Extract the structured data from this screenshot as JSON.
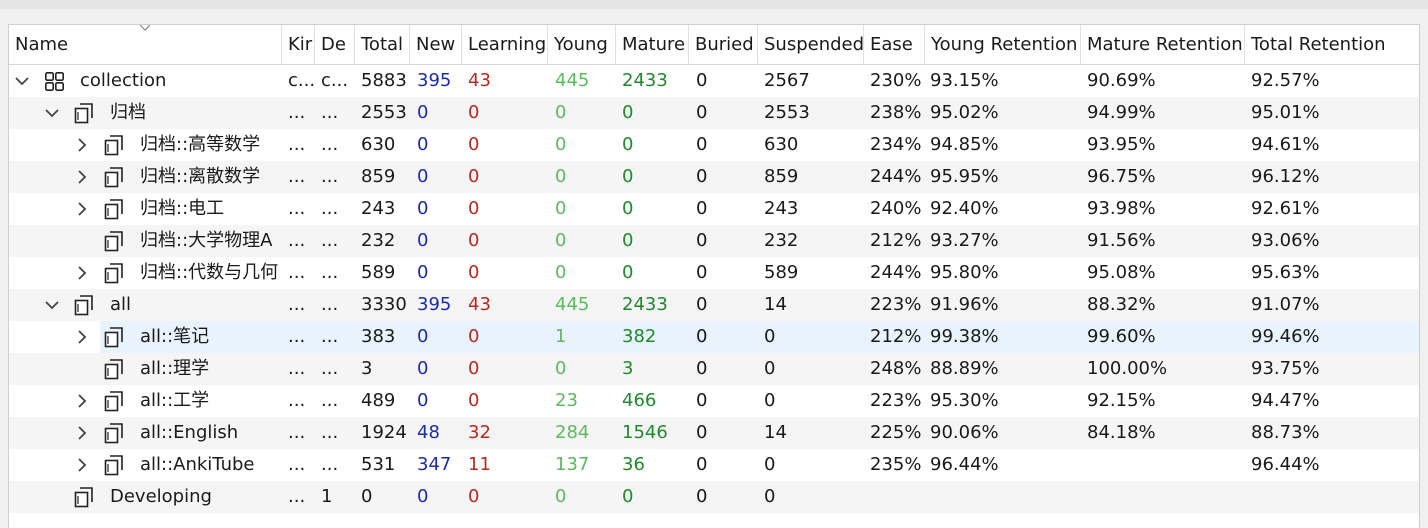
{
  "columns": {
    "name": "Name",
    "kind": "Kir",
    "desc": "De",
    "total": "Total",
    "new": "New",
    "learning": "Learning",
    "young": "Young",
    "mature": "Mature",
    "buried": "Buried",
    "suspended": "Suspended",
    "ease": "Ease",
    "young_ret": "Young Retention",
    "mature_ret": "Mature Retention",
    "total_ret": "Total Retention"
  },
  "colors": {
    "new": "#1c2bad",
    "learning": "#c0271c",
    "young": "#5dba5d",
    "mature": "#1f8a2b",
    "selected_row": "#e8f3fd"
  },
  "rows": [
    {
      "name": "collection",
      "icon": "collection-icon",
      "expand": "expanded",
      "kind": "c...",
      "desc": "c...",
      "total": "5883",
      "new": "395",
      "learning": "43",
      "young": "445",
      "mature": "2433",
      "buried": "0",
      "suspended": "2567",
      "ease": "230%",
      "young_ret": "93.15%",
      "mature_ret": "90.69%",
      "total_ret": "92.57%"
    },
    {
      "name": "归档",
      "icon": "deck-icon",
      "expand": "expanded",
      "kind": "...",
      "desc": "...",
      "total": "2553",
      "new": "0",
      "learning": "0",
      "young": "0",
      "mature": "0",
      "buried": "0",
      "suspended": "2553",
      "ease": "238%",
      "young_ret": "95.02%",
      "mature_ret": "94.99%",
      "total_ret": "95.01%"
    },
    {
      "name": "归档::高等数学",
      "icon": "deck-icon",
      "expand": "collapsed",
      "kind": "...",
      "desc": "...",
      "total": "630",
      "new": "0",
      "learning": "0",
      "young": "0",
      "mature": "0",
      "buried": "0",
      "suspended": "630",
      "ease": "234%",
      "young_ret": "94.85%",
      "mature_ret": "93.95%",
      "total_ret": "94.61%"
    },
    {
      "name": "归档::离散数学",
      "icon": "deck-icon",
      "expand": "collapsed",
      "kind": "...",
      "desc": "...",
      "total": "859",
      "new": "0",
      "learning": "0",
      "young": "0",
      "mature": "0",
      "buried": "0",
      "suspended": "859",
      "ease": "244%",
      "young_ret": "95.95%",
      "mature_ret": "96.75%",
      "total_ret": "96.12%"
    },
    {
      "name": "归档::电工",
      "icon": "deck-icon",
      "expand": "collapsed",
      "kind": "...",
      "desc": "...",
      "total": "243",
      "new": "0",
      "learning": "0",
      "young": "0",
      "mature": "0",
      "buried": "0",
      "suspended": "243",
      "ease": "240%",
      "young_ret": "92.40%",
      "mature_ret": "93.98%",
      "total_ret": "92.61%"
    },
    {
      "name": "归档::大学物理A",
      "icon": "deck-icon",
      "expand": "none",
      "kind": "...",
      "desc": "...",
      "total": "232",
      "new": "0",
      "learning": "0",
      "young": "0",
      "mature": "0",
      "buried": "0",
      "suspended": "232",
      "ease": "212%",
      "young_ret": "93.27%",
      "mature_ret": "91.56%",
      "total_ret": "93.06%"
    },
    {
      "name": "归档::代数与几何",
      "icon": "deck-icon",
      "expand": "collapsed",
      "kind": "...",
      "desc": "...",
      "total": "589",
      "new": "0",
      "learning": "0",
      "young": "0",
      "mature": "0",
      "buried": "0",
      "suspended": "589",
      "ease": "244%",
      "young_ret": "95.80%",
      "mature_ret": "95.08%",
      "total_ret": "95.63%"
    },
    {
      "name": "all",
      "icon": "deck-icon",
      "expand": "expanded",
      "kind": "...",
      "desc": "...",
      "total": "3330",
      "new": "395",
      "learning": "43",
      "young": "445",
      "mature": "2433",
      "buried": "0",
      "suspended": "14",
      "ease": "223%",
      "young_ret": "91.96%",
      "mature_ret": "88.32%",
      "total_ret": "91.07%"
    },
    {
      "name": "all::笔记",
      "icon": "deck-icon",
      "expand": "collapsed",
      "selected": true,
      "kind": "...",
      "desc": "...",
      "total": "383",
      "new": "0",
      "learning": "0",
      "young": "1",
      "mature": "382",
      "buried": "0",
      "suspended": "0",
      "ease": "212%",
      "young_ret": "99.38%",
      "mature_ret": "99.60%",
      "total_ret": "99.46%"
    },
    {
      "name": "all::理学",
      "icon": "deck-icon",
      "expand": "none",
      "kind": "...",
      "desc": "...",
      "total": "3",
      "new": "0",
      "learning": "0",
      "young": "0",
      "mature": "3",
      "buried": "0",
      "suspended": "0",
      "ease": "248%",
      "young_ret": "88.89%",
      "mature_ret": "100.00%",
      "total_ret": "93.75%"
    },
    {
      "name": "all::工学",
      "icon": "deck-icon",
      "expand": "collapsed",
      "kind": "...",
      "desc": "...",
      "total": "489",
      "new": "0",
      "learning": "0",
      "young": "23",
      "mature": "466",
      "buried": "0",
      "suspended": "0",
      "ease": "223%",
      "young_ret": "95.30%",
      "mature_ret": "92.15%",
      "total_ret": "94.47%"
    },
    {
      "name": "all::English",
      "icon": "deck-icon",
      "expand": "collapsed",
      "kind": "...",
      "desc": "...",
      "total": "1924",
      "new": "48",
      "learning": "32",
      "young": "284",
      "mature": "1546",
      "buried": "0",
      "suspended": "14",
      "ease": "225%",
      "young_ret": "90.06%",
      "mature_ret": "84.18%",
      "total_ret": "88.73%"
    },
    {
      "name": "all::AnkiTube",
      "icon": "deck-icon",
      "expand": "collapsed",
      "kind": "...",
      "desc": "...",
      "total": "531",
      "new": "347",
      "learning": "11",
      "young": "137",
      "mature": "36",
      "buried": "0",
      "suspended": "0",
      "ease": "235%",
      "young_ret": "96.44%",
      "mature_ret": "",
      "total_ret": "96.44%"
    },
    {
      "name": "Developing",
      "icon": "deck-icon",
      "expand": "none",
      "kind": "...",
      "desc": "1",
      "total": "0",
      "new": "0",
      "learning": "0",
      "young": "0",
      "mature": "0",
      "buried": "0",
      "suspended": "0",
      "ease": "",
      "young_ret": "",
      "mature_ret": "",
      "total_ret": ""
    }
  ]
}
